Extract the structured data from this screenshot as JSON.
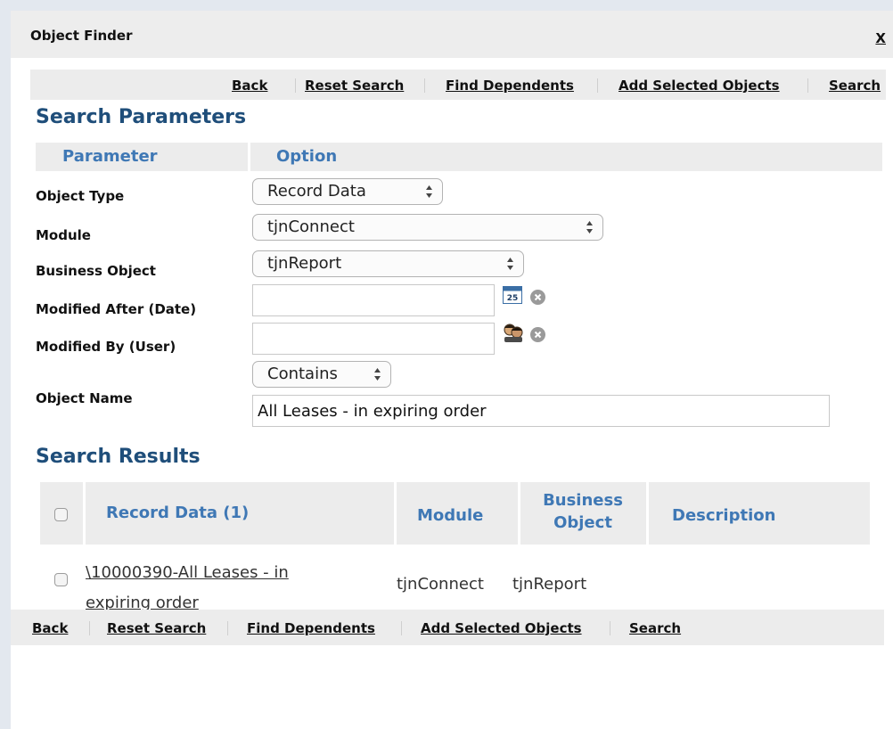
{
  "dialog": {
    "title": "Object Finder",
    "close_label": "X"
  },
  "toolbar": {
    "back": "Back",
    "reset_search": "Reset Search",
    "find_dependents": "Find Dependents",
    "add_selected": "Add Selected Objects",
    "search": "Search"
  },
  "search_parameters": {
    "heading": "Search Parameters",
    "col_parameter": "Parameter",
    "col_option": "Option",
    "object_type": {
      "label": "Object Type",
      "value": "Record Data"
    },
    "module": {
      "label": "Module",
      "value": "tjnConnect"
    },
    "business_object": {
      "label": "Business Object",
      "value": "tjnReport"
    },
    "modified_after": {
      "label": "Modified After (Date)",
      "value": "",
      "calendar_day": "25"
    },
    "modified_by": {
      "label": "Modified By (User)",
      "value": ""
    },
    "object_name": {
      "label": "Object Name",
      "match_mode": "Contains",
      "value": "All Leases - in expiring order"
    }
  },
  "search_results": {
    "heading": "Search Results",
    "columns": {
      "record_data": "Record Data (1)",
      "module": "Module",
      "business_object_line1": "Business",
      "business_object_line2": "Object",
      "description": "Description"
    },
    "rows": [
      {
        "name": "\\10000390-All Leases - in expiring order",
        "module": "tjnConnect",
        "business_object": "tjnReport",
        "description": ""
      }
    ]
  },
  "bottombar": {
    "back": "Back",
    "reset_search": "Reset Search",
    "find_dependents": "Find Dependents",
    "add_selected": "Add Selected Objects",
    "search": "Search"
  },
  "colors": {
    "heading": "#1f4e7a",
    "column_header": "#3f78b5",
    "header_bg": "#ececec"
  }
}
